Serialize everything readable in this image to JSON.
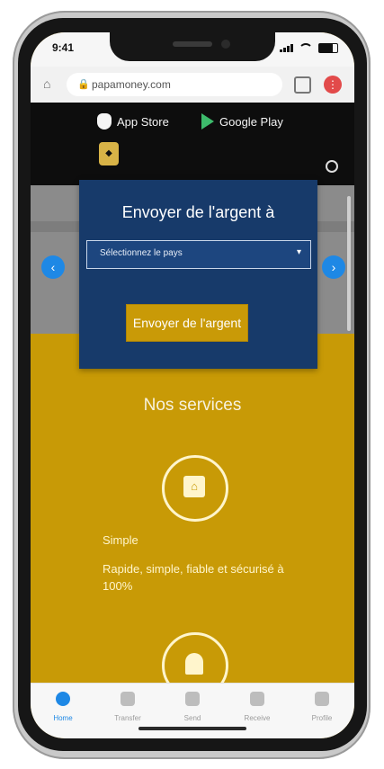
{
  "status_bar": {
    "time": "9:41"
  },
  "browser": {
    "url": "papamoney.com"
  },
  "site": {
    "app_store_label": "App Store",
    "google_play_label": "Google Play"
  },
  "send_card": {
    "title": "Envoyer de l'argent à",
    "select_placeholder": "Sélectionnez le pays",
    "send_button": "Envoyer de l'argent"
  },
  "services": {
    "title": "Nos services",
    "items": [
      {
        "name": "Simple",
        "description": "Rapide, simple, fiable et sécurisé à 100%"
      }
    ]
  },
  "bottom_nav": {
    "items": [
      {
        "label": "Home",
        "active": true
      },
      {
        "label": "Transfer",
        "active": false
      },
      {
        "label": "Send",
        "active": false
      },
      {
        "label": "Receive",
        "active": false
      },
      {
        "label": "Profile",
        "active": false
      }
    ]
  },
  "colors": {
    "brand_gold": "#c89a06",
    "card_navy": "#173a6a",
    "accent_blue": "#1e88e5"
  },
  "icons": [
    "home-icon",
    "lock-icon",
    "tabs-icon",
    "menu-icon",
    "apple-icon",
    "google-play-icon",
    "search-icon",
    "chevron-left-icon",
    "chevron-right-icon",
    "service-icon"
  ]
}
